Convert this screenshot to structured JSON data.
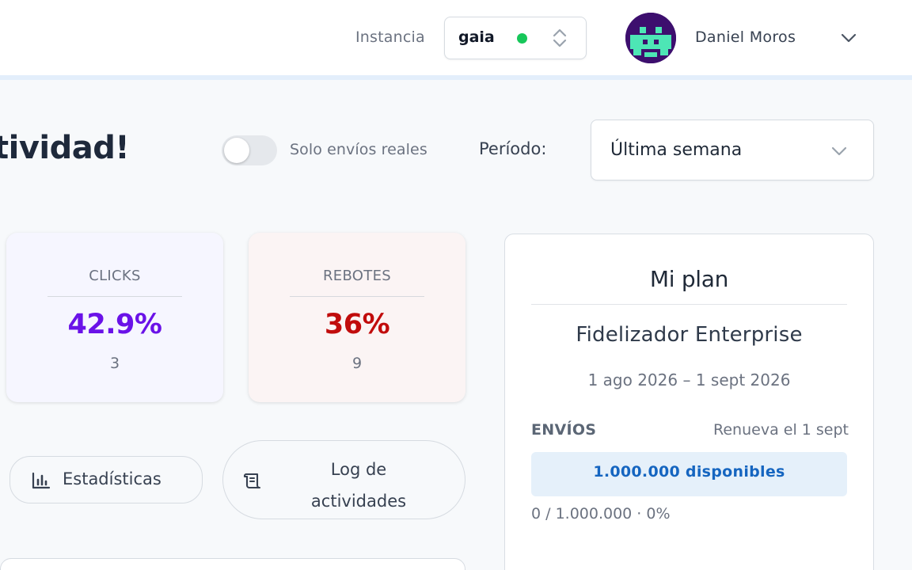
{
  "header": {
    "instance_label": "Instancia",
    "instance_value": "gaia",
    "instance_status_color": "#17c75a",
    "user_name": "Daniel Moros",
    "avatar_icon": "pixel-invader-avatar"
  },
  "toolbar": {
    "heading": "tividad!",
    "toggle_label": "Solo envíos reales",
    "toggle_on": false,
    "period_label": "Período:",
    "period_value": "Última semana"
  },
  "stats": [
    {
      "title": "CLICKS",
      "value": "42.9%",
      "count": "3",
      "color": "#6a12e8"
    },
    {
      "title": "REBOTES",
      "value": "36%",
      "count": "9",
      "color": "#c10c0c"
    }
  ],
  "buttons": {
    "stats_label": "Estadísticas",
    "stats_icon": "bar-chart-icon",
    "log_label": "Log de actividades",
    "log_icon": "scroll-icon"
  },
  "plan": {
    "title": "Mi plan",
    "name": "Fidelizador Enterprise",
    "dates": "1 ago 2026 – 1 sept 2026",
    "sends_label": "ENVÍOS",
    "renew_text": "Renueva el 1 sept",
    "available_text": "1.000.000 disponibles",
    "usage_text": "0 / 1.000.000 · 0%",
    "usage_fraction": 0
  }
}
